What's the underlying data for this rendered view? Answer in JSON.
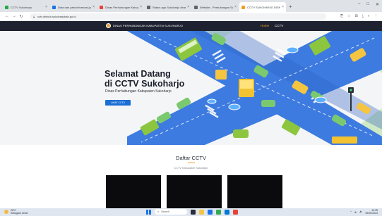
{
  "browser": {
    "tabs": [
      {
        "label": "CCTV Sukoharjo",
        "color": "#22a845",
        "active": false
      },
      {
        "label": "Data dan peta informasi jalan",
        "color": "#1a73e8",
        "active": false
      },
      {
        "label": "Dinas Perhubungan Kabupaten",
        "color": "#e94235",
        "active": false
      },
      {
        "label": "Status app Sukoharjo dinas perhub",
        "color": "#5f6368",
        "active": false
      },
      {
        "label": "Website - Perhubungan Sukoharjo",
        "color": "#5f6368",
        "active": false
      },
      {
        "label": "CCTV SUKOHARJO DISHUB",
        "color": "#f0a020",
        "active": true
      }
    ],
    "new_tab": "+",
    "window_controls": [
      "–",
      "□",
      "✕"
    ],
    "nav": {
      "back": "←",
      "forward": "→",
      "reload": "↻"
    },
    "url": "cctv.dishub.sukoharjokab.go.id",
    "toolbar_icons": [
      "⎘",
      "☆",
      "⊞",
      "⤓",
      "◐",
      "⋮"
    ]
  },
  "site": {
    "brand": "DINAS PERHUBUNGAN KABUPATEN SUKOHARJO",
    "nav": {
      "home": "Home",
      "cctv": "CCTV"
    }
  },
  "hero": {
    "title_line1": "Selamat Datang",
    "title_line2": "di CCTV Sukoharjo",
    "subtitle": "Dinas Perhubungan Kabupaten Sukoharjo",
    "button": "LIHAT CCTV"
  },
  "cctv_section": {
    "title": "Daftar CCTV",
    "subtitle": "CCTV Kabupaten Sukoharjo",
    "accent": "#f0a020"
  },
  "taskbar": {
    "weather_temp": "26°C",
    "weather_text": "Sebagian cerah",
    "search_placeholder": "Search",
    "time": "10:35",
    "date": "09/09/2024",
    "tray_icons": [
      "^",
      "☁",
      "🔊"
    ]
  },
  "colors": {
    "nav_bg": "#1e2230",
    "button_blue": "#1a6fd4",
    "road": "#3d7be0",
    "road_dark": "#2f63c2",
    "grass": "#cfe9c4"
  }
}
